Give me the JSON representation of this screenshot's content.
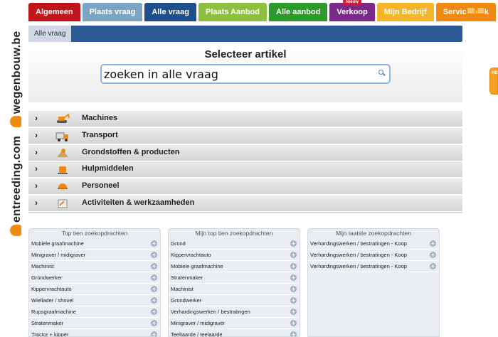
{
  "brand": {
    "part1": "entreeding.com",
    "part2": "wegenbouw.be"
  },
  "tabs": [
    {
      "label": "Algemeen",
      "color": "#c0161b"
    },
    {
      "label": "Plaats vraag",
      "color": "#7aa6c4"
    },
    {
      "label": "Alle vraag",
      "color": "#1f4e8c"
    },
    {
      "label": "Plaats Aanbod",
      "color": "#8cc03e"
    },
    {
      "label": "Alle aanbod",
      "color": "#2c9b2c"
    },
    {
      "label": "Verkoop",
      "color": "#7b2a8c",
      "badge": "Nieuw"
    },
    {
      "label": "Mijn Bedrijf",
      "color": "#f5b62b"
    },
    {
      "label": "Servicedesk",
      "color": "#f08a10"
    }
  ],
  "breadcrumb": {
    "label": "Alle vraag"
  },
  "search": {
    "title": "Selecteer artikel",
    "value": "zoeken in alle vraag",
    "placeholder": ""
  },
  "categories": [
    {
      "label": "Machines",
      "icon": "excavator-icon"
    },
    {
      "label": "Transport",
      "icon": "truck-icon"
    },
    {
      "label": "Grondstoffen & producten",
      "icon": "materials-icon"
    },
    {
      "label": "Hulpmiddelen",
      "icon": "tools-icon"
    },
    {
      "label": "Personeel",
      "icon": "worker-helmet-icon"
    },
    {
      "label": "Activiteiten & werkzaamheden",
      "icon": "activities-icon"
    }
  ],
  "lists": [
    {
      "title": "Top tien zoekopdrachten",
      "items": [
        "Mobiele graafmachine",
        "Minigraver / midigraver",
        "Machinist",
        "Grondwerker",
        "Kippervrachtauto",
        "Wiellader / shovel",
        "Rupsgraafmachine",
        "Stratenmaker",
        "Tractor + kipper"
      ]
    },
    {
      "title": "Mijn top tien zoekopdrachten",
      "items": [
        "Grond",
        "Kippervrachtauto",
        "Mobiele graafmachine",
        "Stratenmaker",
        "Machinist",
        "Grondwerker",
        "Verhardingswerken / bestratingen",
        "Minigraver / midigraver",
        "Teeltaarde / teelaarde"
      ]
    },
    {
      "title": "Mijn laatste zoekopdrachten",
      "items": [
        "Verhardingswerken / bestratingen - Koop",
        "Verhardingswerken / bestratingen - Koop",
        "Verhardingswerken / bestratingen - Koop"
      ]
    }
  ],
  "help": {
    "label": "HELP"
  }
}
